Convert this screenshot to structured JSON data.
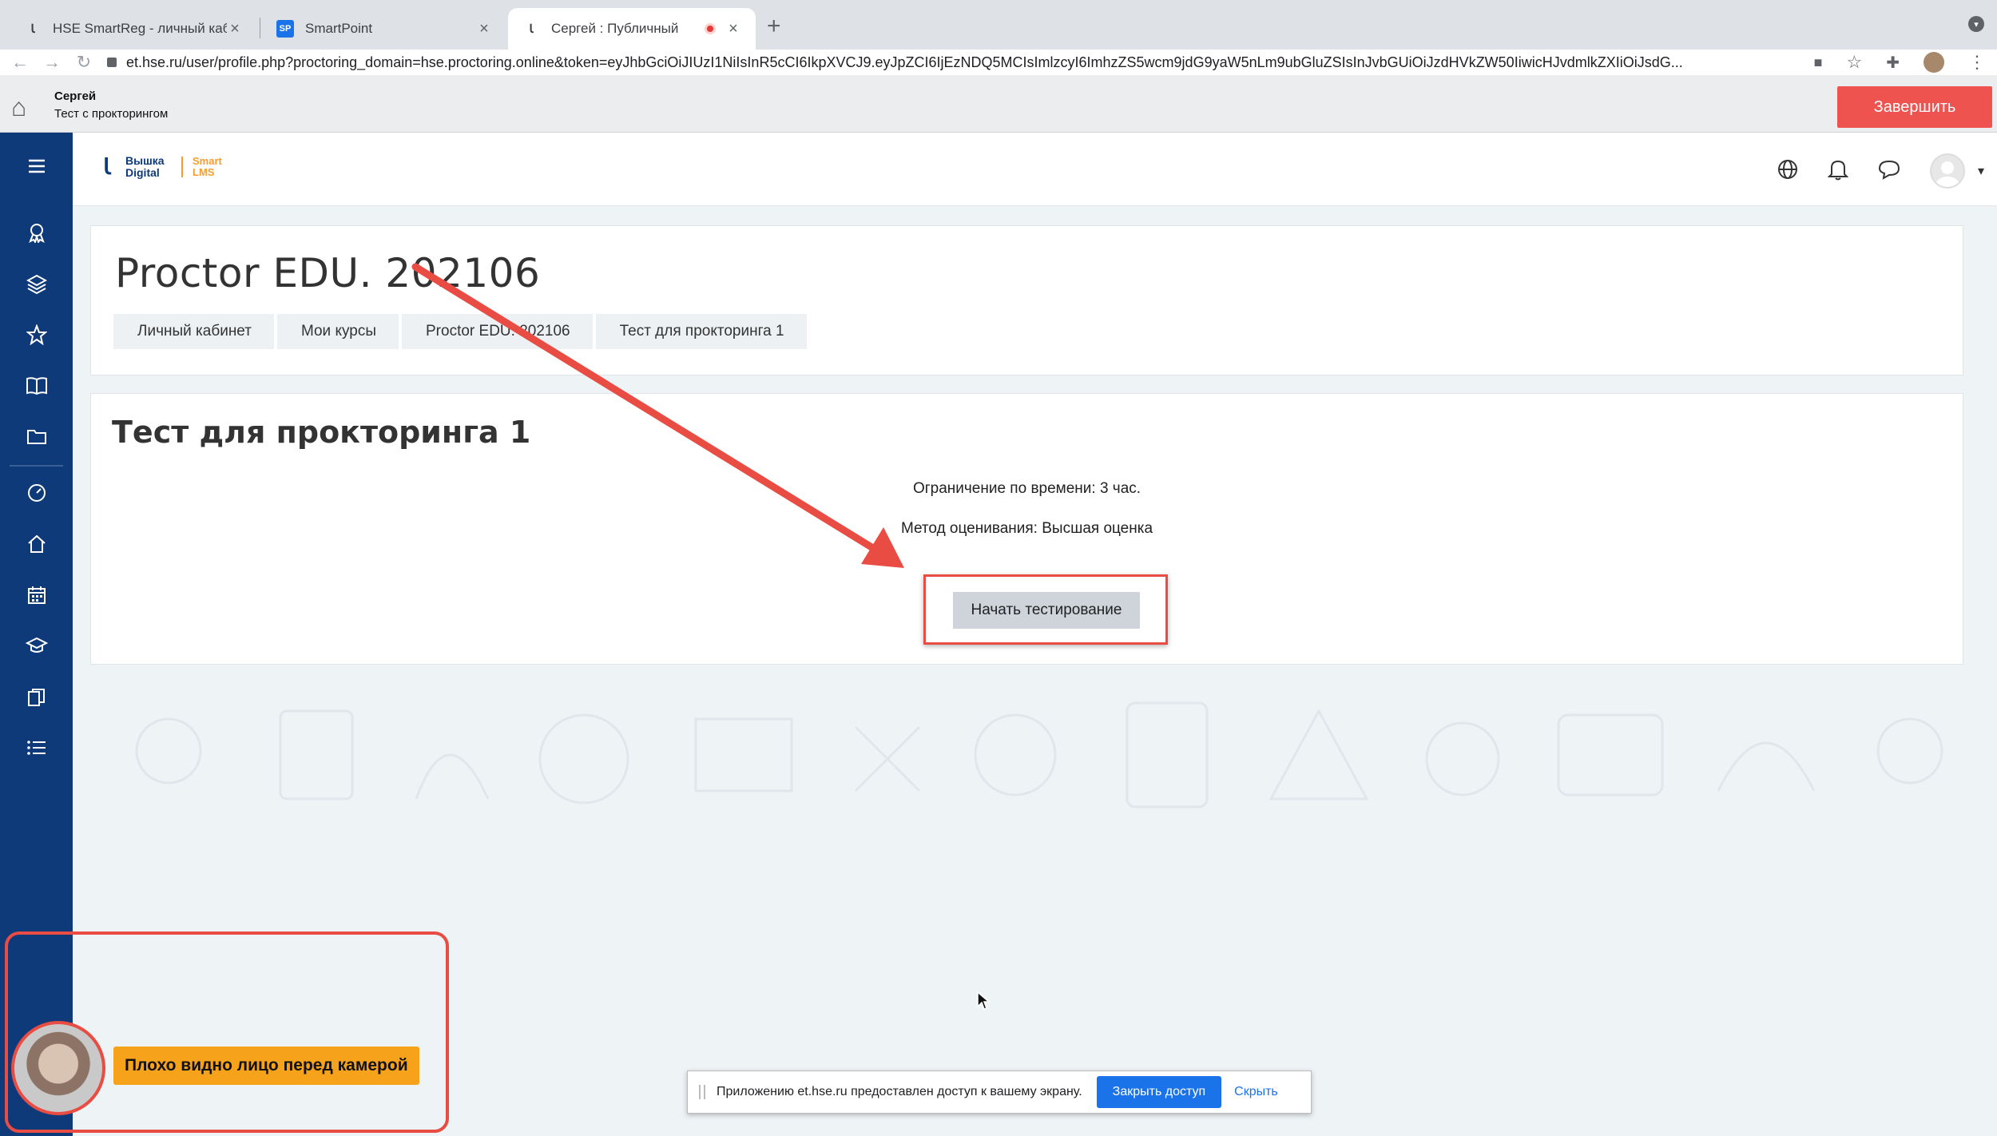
{
  "browser": {
    "tabs": [
      {
        "title": "HSE SmartReg - личный кабинет",
        "favicon": "hse-logo-icon"
      },
      {
        "title": "SmartPoint",
        "favicon": "smartpoint-icon"
      },
      {
        "title": "Сергей           : Публичный",
        "favicon": "hse-logo-icon",
        "recording": true
      }
    ],
    "url": "et.hse.ru/user/profile.php?proctoring_domain=hse.proctoring.online&token=eyJhbGciOiJIUzI1NiIsInR5cCI6IkpXVCJ9.eyJpZCI6IjEzNDQ5MCIsImlzcyI6ImhzZS5wcm9jdG9yaW5nLm9ubGluZSIsInJvbGUiOiJzdHVkZW50IiwicHJvdmlkZXIiOiJsdG..."
  },
  "proctoring": {
    "user_name": "Сергей",
    "session_label": "Тест с прокторингом",
    "finish_label": "Завершить"
  },
  "lms": {
    "logo": {
      "brand": "Вышка Digital",
      "product": "Smart LMS"
    }
  },
  "course": {
    "title": "Proctor EDU. 202106",
    "breadcrumbs": [
      "Личный кабинет",
      "Мои курсы",
      "Proctor EDU. 202106",
      "Тест для прокторинга 1"
    ]
  },
  "quiz": {
    "title": "Тест для прокторинга 1",
    "time_limit": "Ограничение по времени: 3 час.",
    "grading_method": "Метод оценивания: Высшая оценка",
    "start_label": "Начать тестирование"
  },
  "webcam": {
    "warning": "Плохо видно лицо перед камерой"
  },
  "screen_share": {
    "message": "Приложению et.hse.ru предоставлен доступ к вашему экрану.",
    "stop_label": "Закрыть доступ",
    "hide_label": "Скрыть"
  },
  "colors": {
    "sidebar": "#0f3a7a",
    "finish": "#ef5350",
    "highlight": "#e94c42",
    "warning": "#f7a21b",
    "share_button": "#1a73e8"
  }
}
